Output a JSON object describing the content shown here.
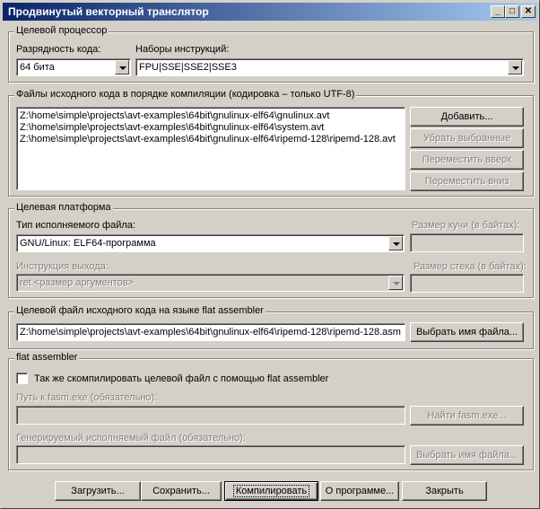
{
  "window": {
    "title": "Продвинутый векторный транслятор"
  },
  "target_cpu": {
    "legend": "Целевой процессор",
    "bitness_label": "Разрядность кода:",
    "bitness_value": "64 бита",
    "isa_label": "Наборы инструкций:",
    "isa_value": "FPU|SSE|SSE2|SSE3"
  },
  "sources": {
    "legend": "Файлы исходного кода в порядке компиляции (кодировка – только UTF-8)",
    "files": [
      "Z:\\home\\simple\\projects\\avt-examples\\64bit\\gnulinux-elf64\\gnulinux.avt",
      "Z:\\home\\simple\\projects\\avt-examples\\64bit\\gnulinux-elf64\\system.avt",
      "Z:\\home\\simple\\projects\\avt-examples\\64bit\\gnulinux-elf64\\ripemd-128\\ripemd-128.avt"
    ],
    "add": "Добавить...",
    "remove": "Убрать выбранные",
    "up": "Переместить вверх",
    "down": "Переместить вниз"
  },
  "platform": {
    "legend": "Целевая платформа",
    "exe_type_label": "Тип исполняемого файла:",
    "exe_type_value": "GNU/Linux: ELF64-программа",
    "exit_label": "Инструкция выхода:",
    "exit_value": "ret <размер аргументов>",
    "heap_label": "Размер кучи (в байтах):",
    "stack_label": "Размер стека (в байтах):"
  },
  "output": {
    "legend": "Целевой файл исходного кода на языке flat assembler",
    "path": "Z:\\home\\simple\\projects\\avt-examples\\64bit\\gnulinux-elf64\\ripemd-128\\ripemd-128.asm",
    "choose": "Выбрать имя файла..."
  },
  "fasm": {
    "legend": "flat assembler",
    "also_compile": "Так же скомпилировать целевой файл с помощью flat assembler",
    "path_label": "Путь к fasm.exe (обязательно):",
    "find": "Найти fasm.exe...",
    "exe_label": "Генерируемый исполняемый файл (обязательно):",
    "choose": "Выбрать имя файла..."
  },
  "footer": {
    "load": "Загрузить...",
    "save": "Сохранить...",
    "compile": "Компилировать",
    "about": "О программе...",
    "close": "Закрыть"
  }
}
